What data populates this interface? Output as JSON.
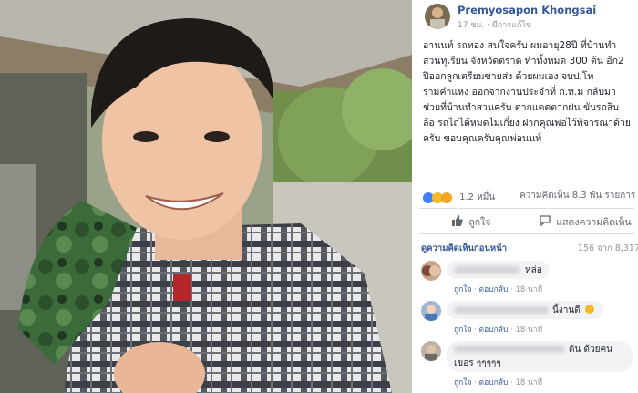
{
  "post": {
    "author_name": "Premyosapon Khongsai",
    "meta_time": "17 ชม.",
    "meta_edited": "· มีการแก้ไข",
    "body_lines": [
      "อานนท์ รถทอง สนใจครับ ผมอายุ28ปี ที่บ้านทำ",
      "สวนทุเรียน จังหวัดตราด ทำทั้งหมด 300 ต้น อีก2",
      "ปีออกลูกเตรียมขายส่ง ด้วยผมเอง จบป.โท",
      "รามคำแหง ออกจากงานประจำที่ ก.ท.ม กลับมา",
      "ช่วยที่บ้านทำสวนครับ ตากแดดตากฝน ขับรถสิบ",
      "ล้อ รถไถได้หมดไม่เกี่ยง ฝากคุณพ่อไว้พิจารณาด้วย",
      "ครับ ขอบคุณครับคุณพ่อนนท์"
    ]
  },
  "stats": {
    "reactions_count": "1.2 หมื่น",
    "comments_shares": "ความคิดเห็น 8.3 พัน รายการ"
  },
  "actions": {
    "like_label": "ถูกใจ",
    "comment_label": "แสดงความคิดเห็น"
  },
  "comments_section": {
    "view_previous": "ดูความคิดเห็นก่อนหน้า",
    "count": "156 จาก 8,317",
    "items": [
      {
        "visible_text": "หล่อ",
        "like": "ถูกใจ",
        "reply": "ตอบกลับ",
        "time": "18 นาที"
      },
      {
        "visible_text": "นี้งานดี",
        "like": "ถูกใจ",
        "reply": "ตอบกลับ",
        "time": "18 นาที"
      },
      {
        "visible_text_right": "ดัน ด้วยคน",
        "visible_text_line2": "เขอร ๆๆๆๆๆ",
        "like": "ถูกใจ",
        "reply": "ตอบกลับ",
        "time": "18 นาที"
      }
    ]
  },
  "icons": {
    "like": "thumbs-up-icon",
    "comment": "speech-bubble-icon",
    "reactions": "reaction-emojis"
  },
  "colors": {
    "fb_blue": "#365899",
    "like_blue": "#4080ff",
    "muted": "#90949c",
    "text": "#1d2129"
  }
}
